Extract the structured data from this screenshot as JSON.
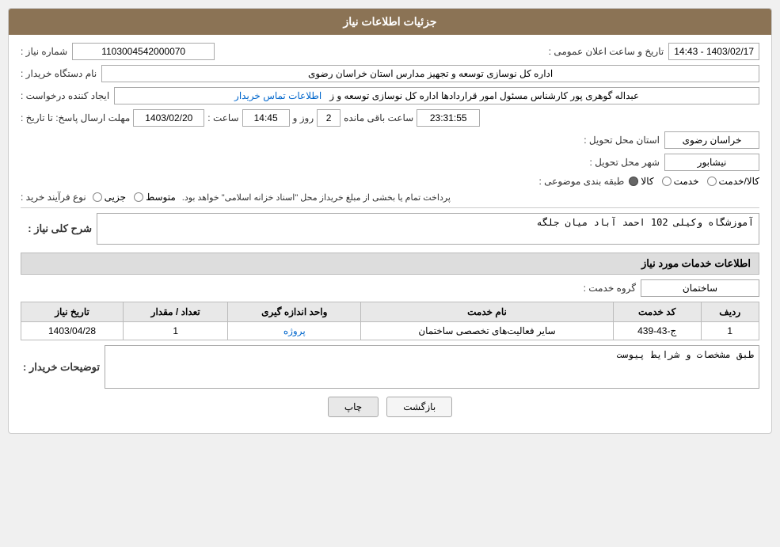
{
  "page": {
    "title": "جزئیات اطلاعات نیاز"
  },
  "header": {
    "title": "جزئیات اطلاعات نیاز"
  },
  "fields": {
    "need_number_label": "شماره نیاز :",
    "need_number_value": "1103004542000070",
    "announce_datetime_label": "تاریخ و ساعت اعلان عمومی :",
    "announce_datetime_value": "1403/02/17 - 14:43",
    "buyer_org_label": "نام دستگاه خریدار :",
    "buyer_org_value": "اداره کل نوسازی  توسعه و تجهیز مدارس استان خراسان رضوی",
    "creator_label": "ایجاد کننده درخواست :",
    "creator_value": "عبداله گوهری پور کارشناس مسئول امور قراردادها  اداره کل نوسازی  توسعه و ز",
    "creator_link": "اطلاعات تماس خریدار",
    "deadline_label": "مهلت ارسال پاسخ: تا تاریخ :",
    "deadline_date": "1403/02/20",
    "deadline_time_label": "ساعت :",
    "deadline_time": "14:45",
    "deadline_day_label": "روز و",
    "deadline_days": "2",
    "deadline_remaining_label": "ساعت باقی مانده",
    "deadline_remaining": "23:31:55",
    "province_label": "استان محل تحویل :",
    "province_value": "خراسان رضوی",
    "city_label": "شهر محل تحویل :",
    "city_value": "نیشابور",
    "category_label": "طبقه بندی موضوعی :",
    "category_options": [
      {
        "label": "کالا",
        "selected": false
      },
      {
        "label": "خدمت",
        "selected": false
      },
      {
        "label": "کالا/خدمت",
        "selected": false
      }
    ],
    "purchase_type_label": "نوع فرآیند خرید :",
    "purchase_note": "پرداخت تمام یا بخشی از مبلغ خریداز محل \"اسناد خزانه اسلامی\" خواهد بود.",
    "purchase_types": [
      {
        "label": "جزیی",
        "selected": false
      },
      {
        "label": "متوسط",
        "selected": false
      }
    ]
  },
  "need_description": {
    "section_title": "شرح کلی نیاز :",
    "value": "آموزشگاه وکیلی 102 احمد آباد میان جلگه"
  },
  "services_section": {
    "section_title": "اطلاعات خدمات مورد نیاز",
    "service_group_label": "گروه خدمت :",
    "service_group_value": "ساختمان",
    "table": {
      "columns": [
        "ردیف",
        "کد خدمت",
        "نام خدمت",
        "واحد اندازه گیری",
        "تعداد / مقدار",
        "تاریخ نیاز"
      ],
      "rows": [
        {
          "row_num": "1",
          "service_code": "ج-43-439",
          "service_name": "سایر فعالیت‌های تخصصی ساختمان",
          "unit": "پروژه",
          "quantity": "1",
          "need_date": "1403/04/28"
        }
      ]
    }
  },
  "buyer_notes": {
    "section_title": "توضیحات خریدار :",
    "value": "طبق مشخصات و شرایط پیوست"
  },
  "buttons": {
    "print_label": "چاپ",
    "back_label": "بازگشت"
  }
}
